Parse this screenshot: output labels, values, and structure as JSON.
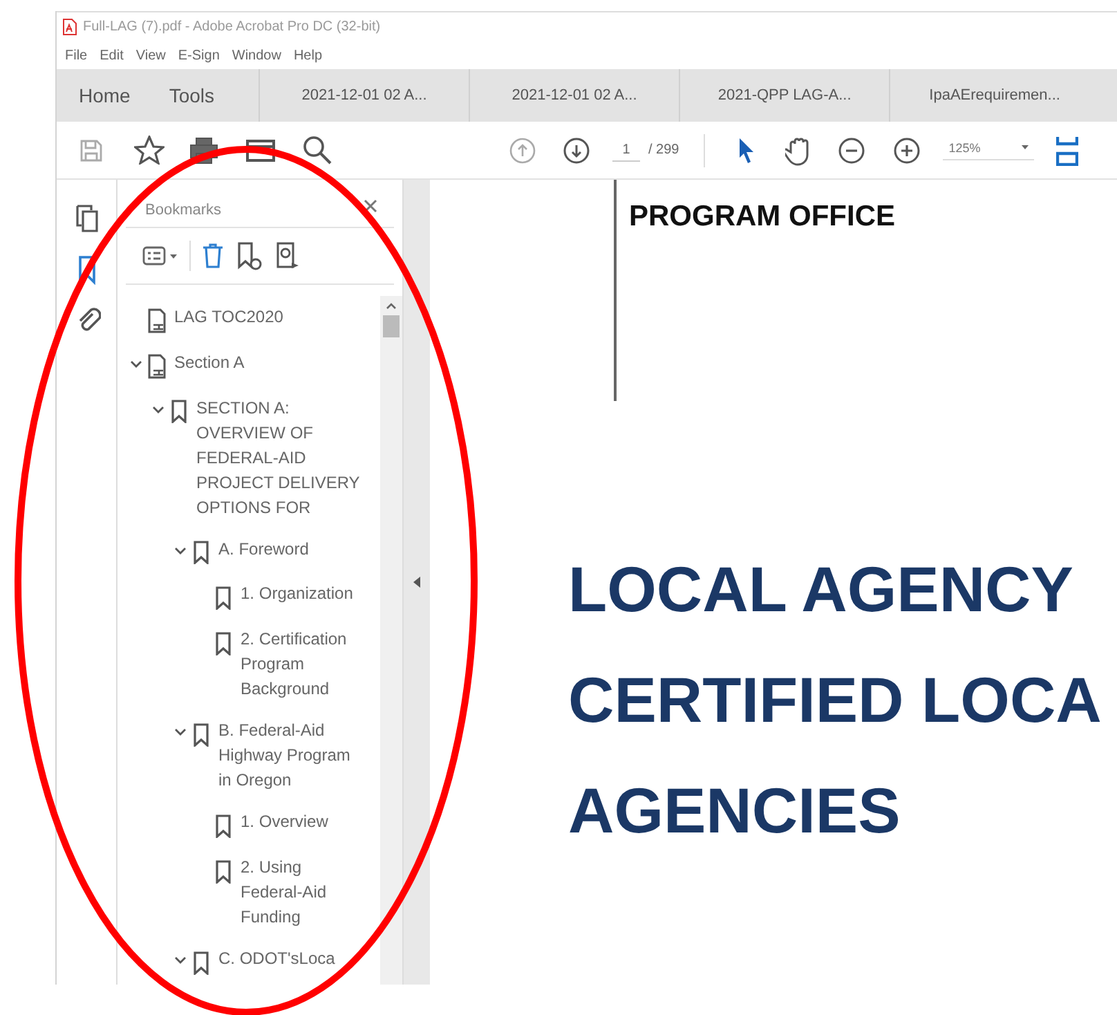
{
  "window": {
    "title": "Full-LAG (7).pdf - Adobe Acrobat Pro DC (32-bit)"
  },
  "menu": [
    "File",
    "Edit",
    "View",
    "E-Sign",
    "Window",
    "Help"
  ],
  "nav_tabs": [
    "Home",
    "Tools"
  ],
  "doc_tabs": [
    {
      "label": "2021-12-01  02 A...",
      "selected": false
    },
    {
      "label": "2021-12-01  02 A...",
      "selected": false
    },
    {
      "label": "2021-QPP LAG-A...",
      "selected": false
    },
    {
      "label": "IpaAErequiremen...",
      "selected": false
    }
  ],
  "toolbar": {
    "page": "1",
    "page_total": "/ 299",
    "zoom": "125%"
  },
  "side_icons": [
    {
      "kind": "pages",
      "selected": false
    },
    {
      "kind": "bookmarks",
      "selected": true
    },
    {
      "kind": "attachments",
      "selected": false
    }
  ],
  "bookmarks_panel": {
    "title": "Bookmarks",
    "items": [
      {
        "kind": "page",
        "label": "LAG TOC2020"
      },
      {
        "kind": "page",
        "label": "Section A",
        "expanded": true,
        "children": [
          {
            "kind": "bookmark",
            "label": "SECTION A: OVERVIEW OF FEDERAL-AID PROJECT DELIVERY OPTIONS FOR",
            "expanded": true,
            "children": [
              {
                "kind": "bookmark",
                "label": "A. Foreword",
                "expanded": true,
                "children": [
                  {
                    "kind": "bookmark",
                    "label": "1. Organization"
                  },
                  {
                    "kind": "bookmark",
                    "label": "2. Certification Program Background"
                  }
                ]
              },
              {
                "kind": "bookmark",
                "label": "B. Federal-Aid Highway Program in Oregon",
                "expanded": true,
                "children": [
                  {
                    "kind": "bookmark",
                    "label": "1. Overview"
                  },
                  {
                    "kind": "bookmark",
                    "label": "2. Using Federal-Aid Funding"
                  }
                ]
              },
              {
                "kind": "bookmark",
                "label": "C. ODOT'sLoca",
                "expanded": true
              }
            ]
          }
        ]
      }
    ]
  },
  "document": {
    "heading": "PROGRAM OFFICE",
    "title_lines": [
      "LOCAL AGENCY",
      "CERTIFIED LOCA",
      "AGENCIES"
    ]
  }
}
